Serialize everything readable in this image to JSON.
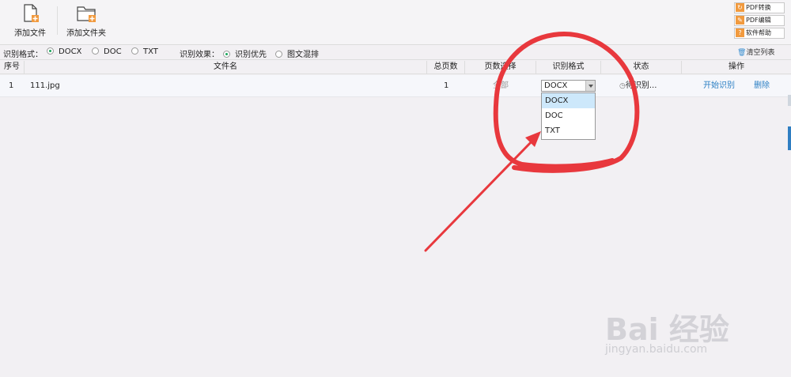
{
  "toolbar": {
    "add_file": "添加文件",
    "add_folder": "添加文件夹"
  },
  "side_buttons": [
    {
      "label": "PDF转换",
      "icon": "convert-icon"
    },
    {
      "label": "PDF编辑",
      "icon": "edit-icon"
    },
    {
      "label": "软件帮助",
      "icon": "help-icon"
    }
  ],
  "options": {
    "format_label": "识别格式：",
    "formats": [
      "DOCX",
      "DOC",
      "TXT"
    ],
    "selected_format": "DOCX",
    "effect_label": "识别效果：",
    "effects": [
      "识别优先",
      "图文混排"
    ],
    "selected_effect": "识别优先",
    "clear_list": "清空列表"
  },
  "table": {
    "headers": [
      "序号",
      "文件名",
      "总页数",
      "页数选择",
      "识别格式",
      "状态",
      "操作"
    ],
    "rows": [
      {
        "index": "1",
        "filename": "111.jpg",
        "pages": "1",
        "page_select": "全部",
        "format": "DOCX",
        "status": "待识别...",
        "action_start": "开始识别",
        "action_delete": "删除"
      }
    ]
  },
  "dropdown": {
    "options": [
      "DOCX",
      "DOC",
      "TXT"
    ],
    "highlighted": "DOCX"
  },
  "watermark": {
    "logo": "Bai 经验",
    "url": "jingyan.baidu.com"
  },
  "colors": {
    "annotation": "#e8383d",
    "accent_green": "#1aa65c",
    "link": "#2b7fc4",
    "icon_orange": "#f19a3e",
    "highlight": "#cde8fb"
  }
}
